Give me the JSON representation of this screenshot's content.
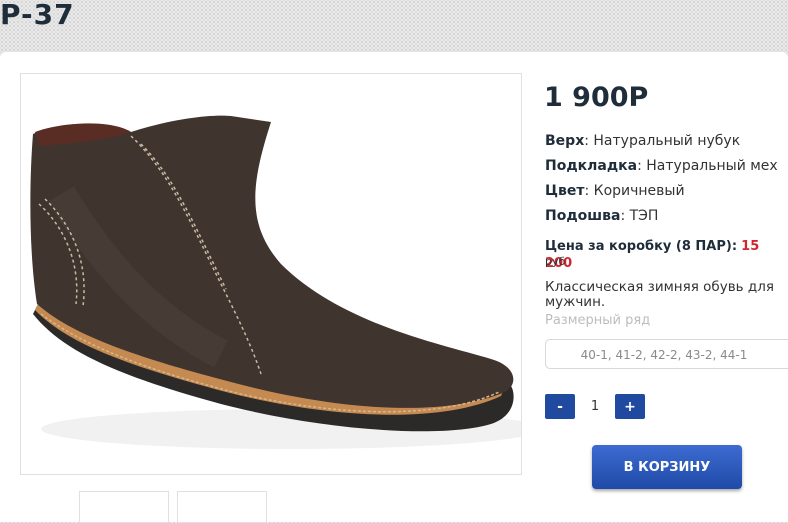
{
  "product": {
    "title": "P-37",
    "price": "1 900P",
    "specs": [
      {
        "key": "Верх",
        "value": "Натуральный нубук"
      },
      {
        "key": "Подкладка",
        "value": "Натуральный мех"
      },
      {
        "key": "Цвет",
        "value": "Коричневый"
      },
      {
        "key": "Подошва",
        "value": "ТЭП"
      }
    ],
    "box_price_label": "Цена за коробку (8 ПАР):",
    "box_price_value": "15 200",
    "box_price_unit": "руб",
    "description": "Классическая зимняя обувь для мужчин.",
    "size_label": "Размерный ряд",
    "size_value": "40-1, 41-2, 42-2, 43-2, 44-1"
  },
  "cart": {
    "minus_label": "-",
    "quantity": "1",
    "plus_label": "+",
    "add_label": "В КОРЗИНУ"
  },
  "colors": {
    "accent": "#1f4aa0",
    "price_red": "#d0262d",
    "title": "#1f2d3a"
  }
}
